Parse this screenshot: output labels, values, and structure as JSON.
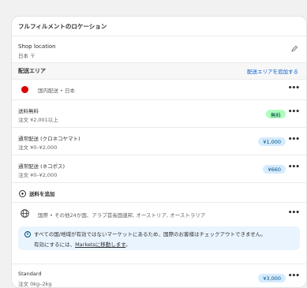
{
  "card": {
    "title": "フルフィルメントのロケーション",
    "shop_location_label": "Shop location",
    "shop_location_value": "日本 〒"
  },
  "zones_header": {
    "title": "配送エリア",
    "add_zone_link": "配送エリアを追加する"
  },
  "domestic": {
    "name": "国内配送 • 日本",
    "rates": [
      {
        "title": "送料無料",
        "condition": "注文 ¥2,001以上",
        "price": "無料",
        "badge": "green"
      },
      {
        "title": "通常配送 (クロネコヤマト)",
        "condition": "注文 ¥0–¥2,000",
        "price": "¥1,000",
        "badge": "blue"
      },
      {
        "title": "通常配送 (ネコポス)",
        "condition": "注文 ¥0–¥2,000",
        "price": "¥660",
        "badge": "blue"
      }
    ],
    "add_rate_label": "送料を追加"
  },
  "international": {
    "name": "国際 • その他24か国、アラブ首長国連邦, オーストリア, オーストラリア",
    "banner_line1": "すべての国/地域が有効ではないマーケットにあるため、国際のお客様はチェックアウトできません。",
    "banner_line2_prefix": "有効にするには、",
    "banner_link": "Marketsに移動します",
    "banner_line2_suffix": "。",
    "rates": [
      {
        "title": "Standard",
        "condition": "注文 0kg–2kg",
        "price": "¥3,000",
        "badge": "blue"
      }
    ]
  },
  "colors": {
    "accent": "#005bd3",
    "badge_blue": "#d5ebff",
    "badge_green": "#affebf",
    "flag_red": "#d90000"
  },
  "icons": {
    "edit": "pencil-icon",
    "more": "more-horizontal-icon",
    "add": "plus-circle-icon",
    "globe": "globe-icon",
    "info": "info-icon"
  },
  "more_label": "•••"
}
